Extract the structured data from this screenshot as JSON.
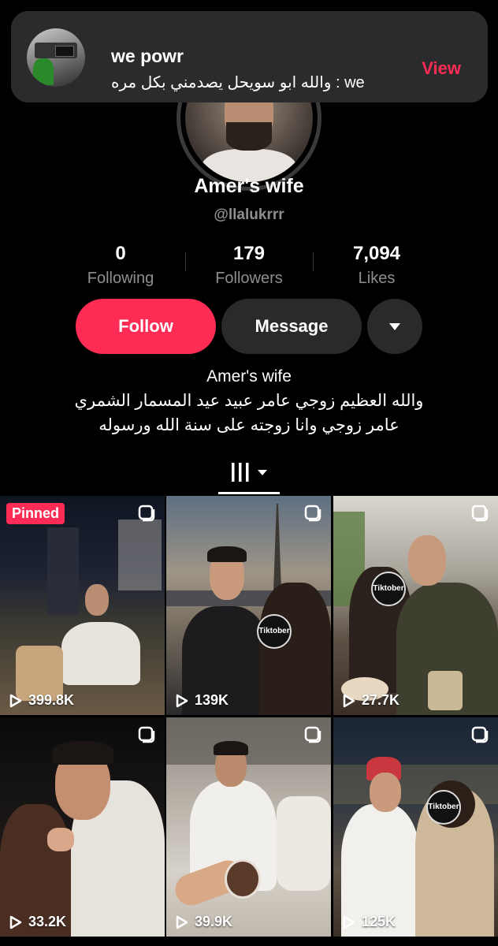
{
  "notification": {
    "title": "we powr",
    "body": "والله ابو سويحل يصدمني بكل مره : we",
    "action_label": "View"
  },
  "profile": {
    "display_name": "Amer's wife",
    "username": "@llalukrrr",
    "stats": [
      {
        "value": "0",
        "label": "Following"
      },
      {
        "value": "179",
        "label": "Followers"
      },
      {
        "value": "7,094",
        "label": "Likes"
      }
    ],
    "buttons": {
      "follow_label": "Follow",
      "message_label": "Message"
    },
    "bio": {
      "name_line": "Amer's wife",
      "line1": "والله العظيم زوجي عامر عبيد عيد المسمار الشمري",
      "line2": "عامر زوجي وانا زوجته على سنة الله ورسوله"
    }
  },
  "videos": [
    {
      "views": "399.8K",
      "pinned_label": "Pinned",
      "watermark": ""
    },
    {
      "views": "139K",
      "watermark": "Tiktober"
    },
    {
      "views": "27.7K",
      "watermark": "Tiktober"
    },
    {
      "views": "33.2K",
      "watermark": ""
    },
    {
      "views": "39.9K",
      "watermark": ""
    },
    {
      "views": "125K",
      "watermark": "Tiktober"
    }
  ],
  "colors": {
    "accent": "#fe2c55",
    "background": "#000000",
    "secondary_button": "#2a2a2c",
    "muted_text": "#8e8e93"
  }
}
